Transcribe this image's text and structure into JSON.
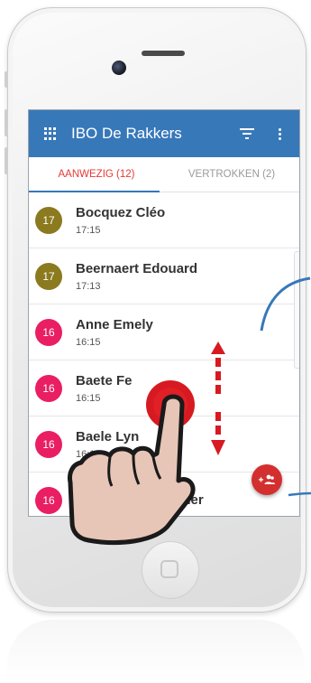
{
  "app": {
    "title": "IBO De Rakkers",
    "menu_icon": "grid-icon",
    "filter_icon": "filter-icon",
    "more_icon": "more-vert-icon",
    "bar_color": "#3778b9"
  },
  "tabs": [
    {
      "label": "AANWEZIG (12)",
      "active": true
    },
    {
      "label": "VERTROKKEN (2)",
      "active": false
    }
  ],
  "children": [
    {
      "age": "17",
      "name": "Bocquez Cléo",
      "time": "17:15",
      "color": "#8b7a1e"
    },
    {
      "age": "17",
      "name": "Beernaert Edouard",
      "time": "17:13",
      "color": "#8b7a1e"
    },
    {
      "age": "16",
      "name": "Anne Emely",
      "time": "16:15",
      "color": "#e91e63"
    },
    {
      "age": "16",
      "name": "Baete Fe",
      "time": "16:15",
      "color": "#e91e63"
    },
    {
      "age": "16",
      "name": "Baele Lyn",
      "time": "16:1",
      "color": "#e91e63"
    },
    {
      "age": "16",
      "name": "sther",
      "time": "",
      "color": "#e91e63"
    }
  ],
  "fab": {
    "icon": "add-group-icon",
    "color": "#d32f2f"
  }
}
